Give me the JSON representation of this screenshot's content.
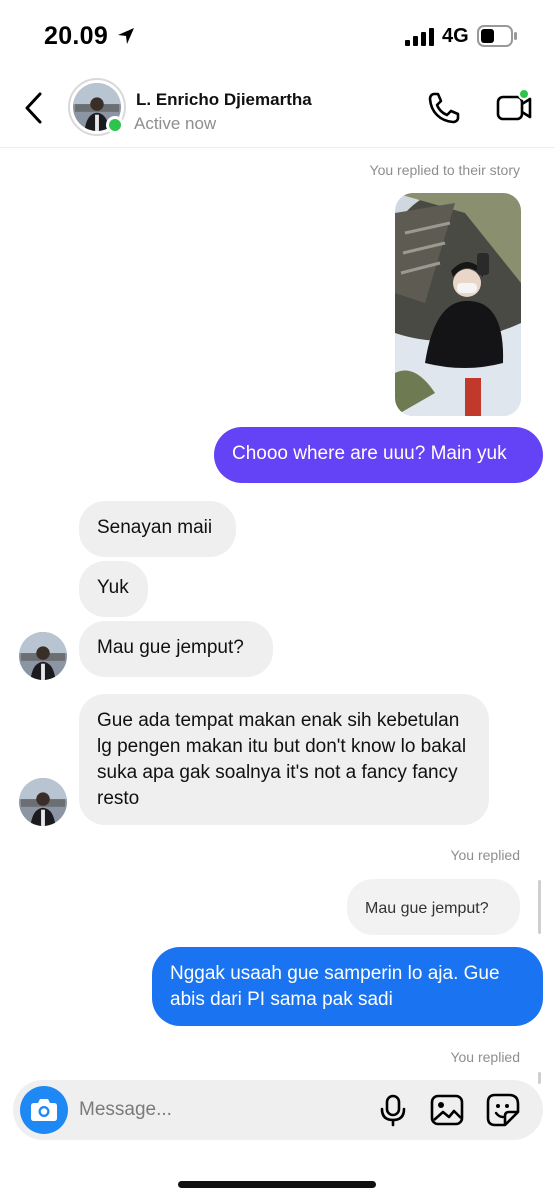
{
  "status_bar": {
    "time": "20.09",
    "network": "4G"
  },
  "header": {
    "contact_name": "L. Enricho Djiemartha",
    "status": "Active now"
  },
  "messages": {
    "story_reply_note": "You replied to their story",
    "sent_1": "Chooo where are uuu? Main yuk",
    "received_1": "Senayan maii",
    "received_2": "Yuk",
    "received_3": "Mau gue jemput?",
    "received_4": "Gue ada tempat makan enak sih kebetulan lg pengen makan itu but don't know lo bakal suka apa gak soalnya it's not a fancy fancy resto",
    "reply_note_1": "You replied",
    "quoted_reply": "Mau gue jemput?",
    "sent_2": "Nggak usaah gue samperin lo aja. Gue abis dari PI sama pak sadi",
    "reply_note_2": "You replied"
  },
  "composer": {
    "placeholder": "Message..."
  },
  "icons": {
    "back": "chevron-left-icon",
    "call": "phone-icon",
    "video": "video-camera-icon",
    "camera": "camera-icon",
    "mic": "microphone-icon",
    "gallery": "image-icon",
    "sticker": "sticker-icon"
  },
  "colors": {
    "sent_bubble_purple": "#6442f5",
    "sent_bubble_blue": "#1a73f0",
    "received_bubble": "#efefef",
    "online": "#2dc44d",
    "camera_button": "#1e88f5"
  }
}
